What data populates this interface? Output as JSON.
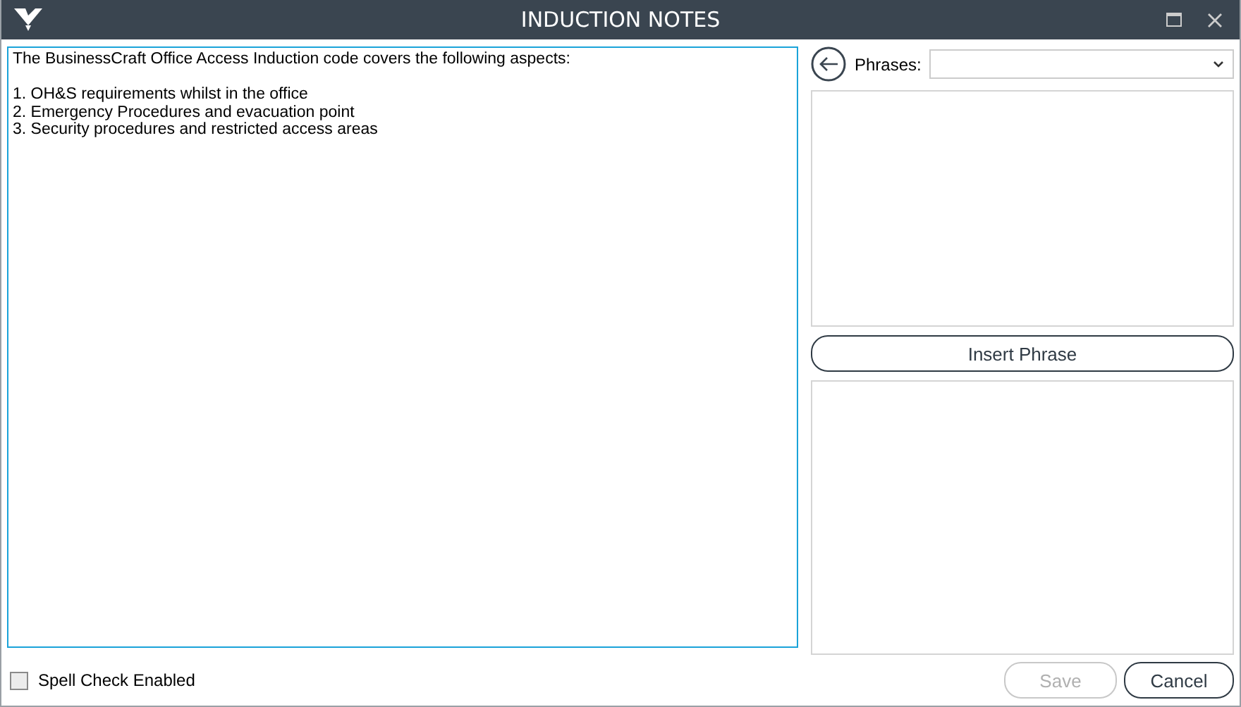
{
  "window": {
    "title": "INDUCTION NOTES"
  },
  "notes": {
    "value": "The BusinessCraft Office Access Induction code covers the following aspects:\n\n1. OH&S requirements whilst in the office\n2. Emergency Procedures and evacuation point\n3. Security procedures and restricted access areas"
  },
  "phrases": {
    "label": "Phrases:"
  },
  "insert_button": {
    "label": "Insert Phrase"
  },
  "spell_check": {
    "label": "Spell Check Enabled",
    "checked": false
  },
  "buttons": [
    {
      "label": "Save",
      "disabled": true
    },
    {
      "label": "Cancel",
      "disabled": false
    }
  ]
}
